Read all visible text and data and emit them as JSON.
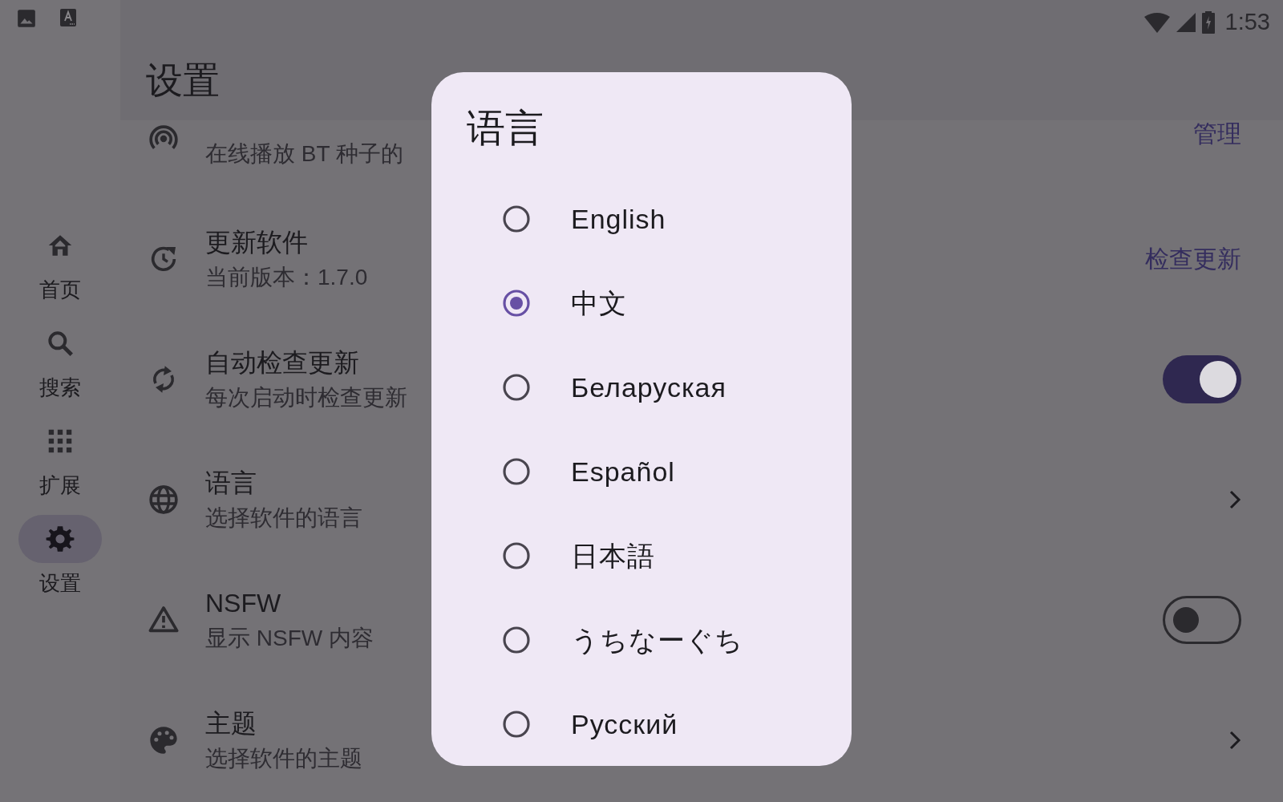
{
  "status_bar": {
    "time": "1:53"
  },
  "nav": [
    {
      "label": "首页",
      "selected": false
    },
    {
      "label": "搜索",
      "selected": false
    },
    {
      "label": "扩展",
      "selected": false
    },
    {
      "label": "设置",
      "selected": true
    }
  ],
  "header": {
    "title": "设置"
  },
  "settings": [
    {
      "subtitle": "在线播放 BT 种子的",
      "trailing": {
        "kind": "link",
        "text": "管理"
      }
    },
    {
      "title": "更新软件",
      "subtitle": "当前版本：1.7.0",
      "trailing": {
        "kind": "link",
        "text": "检查更新"
      }
    },
    {
      "title": "自动检查更新",
      "subtitle": "每次启动时检查更新",
      "trailing": {
        "kind": "switch",
        "on": true
      }
    },
    {
      "title": "语言",
      "subtitle": "选择软件的语言",
      "trailing": {
        "kind": "chevron"
      }
    },
    {
      "title": "NSFW",
      "subtitle": "显示 NSFW 内容",
      "trailing": {
        "kind": "switch",
        "on": false
      }
    },
    {
      "title": "主题",
      "subtitle": "选择软件的主题",
      "trailing": {
        "kind": "chevron"
      }
    }
  ],
  "dialog": {
    "title": "语言",
    "options": [
      {
        "label": "English",
        "selected": false
      },
      {
        "label": "中文",
        "selected": true
      },
      {
        "label": "Беларуская",
        "selected": false
      },
      {
        "label": "Español",
        "selected": false
      },
      {
        "label": "日本語",
        "selected": false
      },
      {
        "label": "うちなーぐち",
        "selected": false
      },
      {
        "label": "Русский",
        "selected": false
      }
    ]
  }
}
